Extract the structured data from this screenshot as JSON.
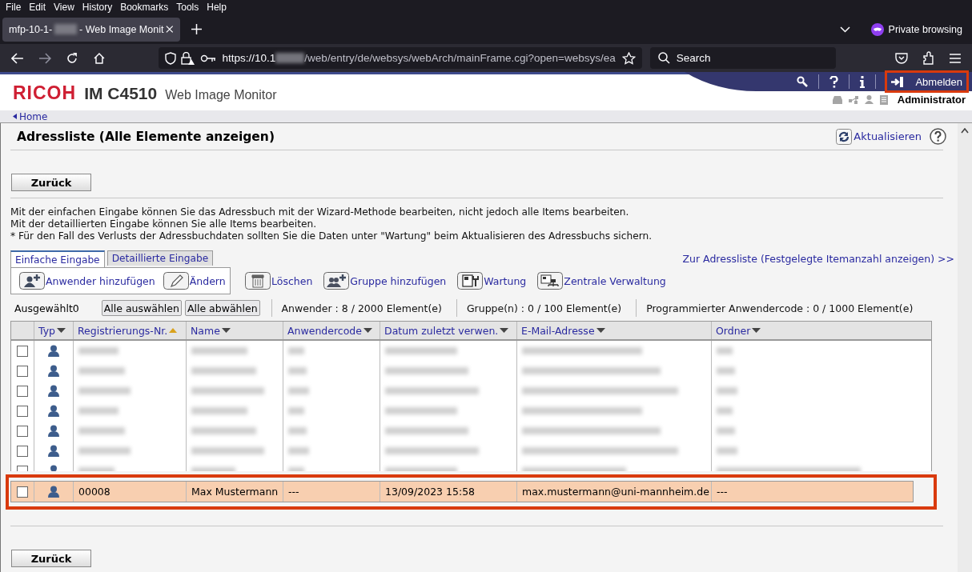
{
  "browser": {
    "menu": [
      "File",
      "Edit",
      "View",
      "History",
      "Bookmarks",
      "Tools",
      "Help"
    ],
    "tab": {
      "title_start": "mfp-10-1-",
      "title_end": "- Web Image Monit"
    },
    "url": {
      "start": "https://10.1",
      "end": "/web/entry/de/websys/webArch/mainFrame.cgi?open=websys/ea"
    },
    "search": {
      "placeholder": "Search"
    },
    "private_label": "Private browsing"
  },
  "header": {
    "brand": "RICOH",
    "model": "IM C4510",
    "product": "Web Image Monitor",
    "logout": {
      "label": "Abmelden",
      "highlighted": true
    },
    "user": "Administrator"
  },
  "breadcrumb": "Home",
  "page": {
    "title": "Adressliste (Alle Elemente anzeigen)",
    "refresh": "Aktualisieren",
    "back_button_top": "Zurück",
    "back_button_bottom": "Zurück",
    "info": [
      "Mit der einfachen Eingabe können Sie das Adressbuch mit der Wizard-Methode bearbeiten, nicht jedoch alle Items bearbeiten.",
      "Mit der detaillierten Eingabe können Sie alle Items bearbeiten.",
      "* Für den Fall des Verlusts der Adressbuchdaten sollten Sie die Daten unter \"Wartung\" beim Aktualisieren des Adressbuchs sichern."
    ],
    "list_link": "Zur Adressliste (Festgelegte Itemanzahl anzeigen) >>"
  },
  "tabs": [
    {
      "label": "Einfache Eingabe",
      "selected": true
    },
    {
      "label": "Detaillierte Eingabe",
      "selected": false
    }
  ],
  "tab_actions": [
    {
      "kind": "add-user",
      "label": "Anwender hinzufügen"
    },
    {
      "kind": "edit",
      "label": "Ändern"
    }
  ],
  "toolbar_actions": [
    {
      "kind": "delete",
      "label": "Löschen"
    },
    {
      "kind": "add-group",
      "label": "Gruppe hinzufügen"
    },
    {
      "kind": "maintenance",
      "label": "Wartung"
    },
    {
      "kind": "central",
      "label": "Zentrale Verwaltung"
    }
  ],
  "summary": {
    "selected": "Ausgewählt0",
    "buttons": [
      "Alle auswählen",
      "Alle abwählen"
    ],
    "counts": [
      "Anwender : 8 / 2000 Element(e)",
      "Gruppe(n) : 0 / 100 Element(e)",
      "Programmierter Anwendercode : 0 / 1000 Element(e)"
    ]
  },
  "table": {
    "columns": [
      {
        "label": "Typ",
        "sort_active": false
      },
      {
        "label": "Registrierungs-Nr.",
        "sort_active": true
      },
      {
        "label": "Name",
        "sort_active": false
      },
      {
        "label": "Anwendercode",
        "sort_active": false
      },
      {
        "label": "Datum zuletzt verwen.",
        "sort_active": false
      },
      {
        "label": "E-Mail-Adresse",
        "sort_active": false
      },
      {
        "label": "Ordner",
        "sort_active": false
      }
    ],
    "rows": [
      {
        "redacted": true,
        "cut": false,
        "checked": false,
        "selected": false,
        "highlighted": false
      },
      {
        "redacted": true,
        "cut": false,
        "checked": false,
        "selected": false,
        "highlighted": false
      },
      {
        "redacted": true,
        "cut": false,
        "checked": false,
        "selected": false,
        "highlighted": false
      },
      {
        "redacted": true,
        "cut": false,
        "checked": false,
        "selected": false,
        "highlighted": false
      },
      {
        "redacted": true,
        "cut": false,
        "checked": false,
        "selected": false,
        "highlighted": false
      },
      {
        "redacted": true,
        "cut": false,
        "checked": false,
        "selected": false,
        "highlighted": false
      },
      {
        "redacted": true,
        "cut": true,
        "checked": false,
        "selected": false,
        "highlighted": false
      },
      {
        "redacted": false,
        "cut": false,
        "checked": false,
        "selected": true,
        "highlighted": true,
        "cells": [
          "00008",
          "Max Mustermann",
          "---",
          "13/09/2023 15:58",
          "max.mustermann@uni-mannheim.de",
          "---"
        ]
      }
    ]
  }
}
